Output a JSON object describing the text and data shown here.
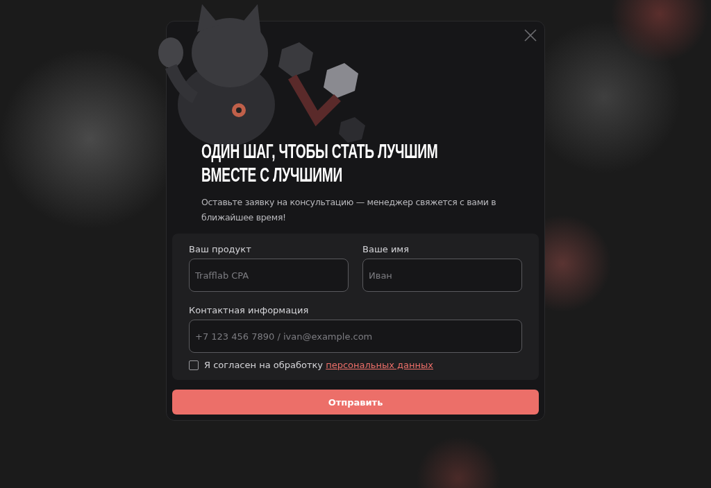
{
  "modal": {
    "title": "ОДИН ШАГ, ЧТОБЫ СТАТЬ ЛУЧШИМ ВМЕСТЕ С ЛУЧШИМИ",
    "subtitle": "Оставьте заявку на консультацию — менеджер свяжется с вами в ближайшее время!",
    "fields": [
      {
        "label": "Ваш продукт",
        "placeholder": "Trafflab CPA",
        "kind": "half"
      },
      {
        "label": "Ваше имя",
        "placeholder": "Иван",
        "kind": "half"
      },
      {
        "label": "Контактная информация",
        "placeholder": "+7 123 456 7890 / ivan@example.com",
        "kind": "full"
      }
    ],
    "consent": {
      "text": "Я согласен на обработку",
      "link": "персональных данных",
      "checked": false
    },
    "submit": "Отправить"
  }
}
